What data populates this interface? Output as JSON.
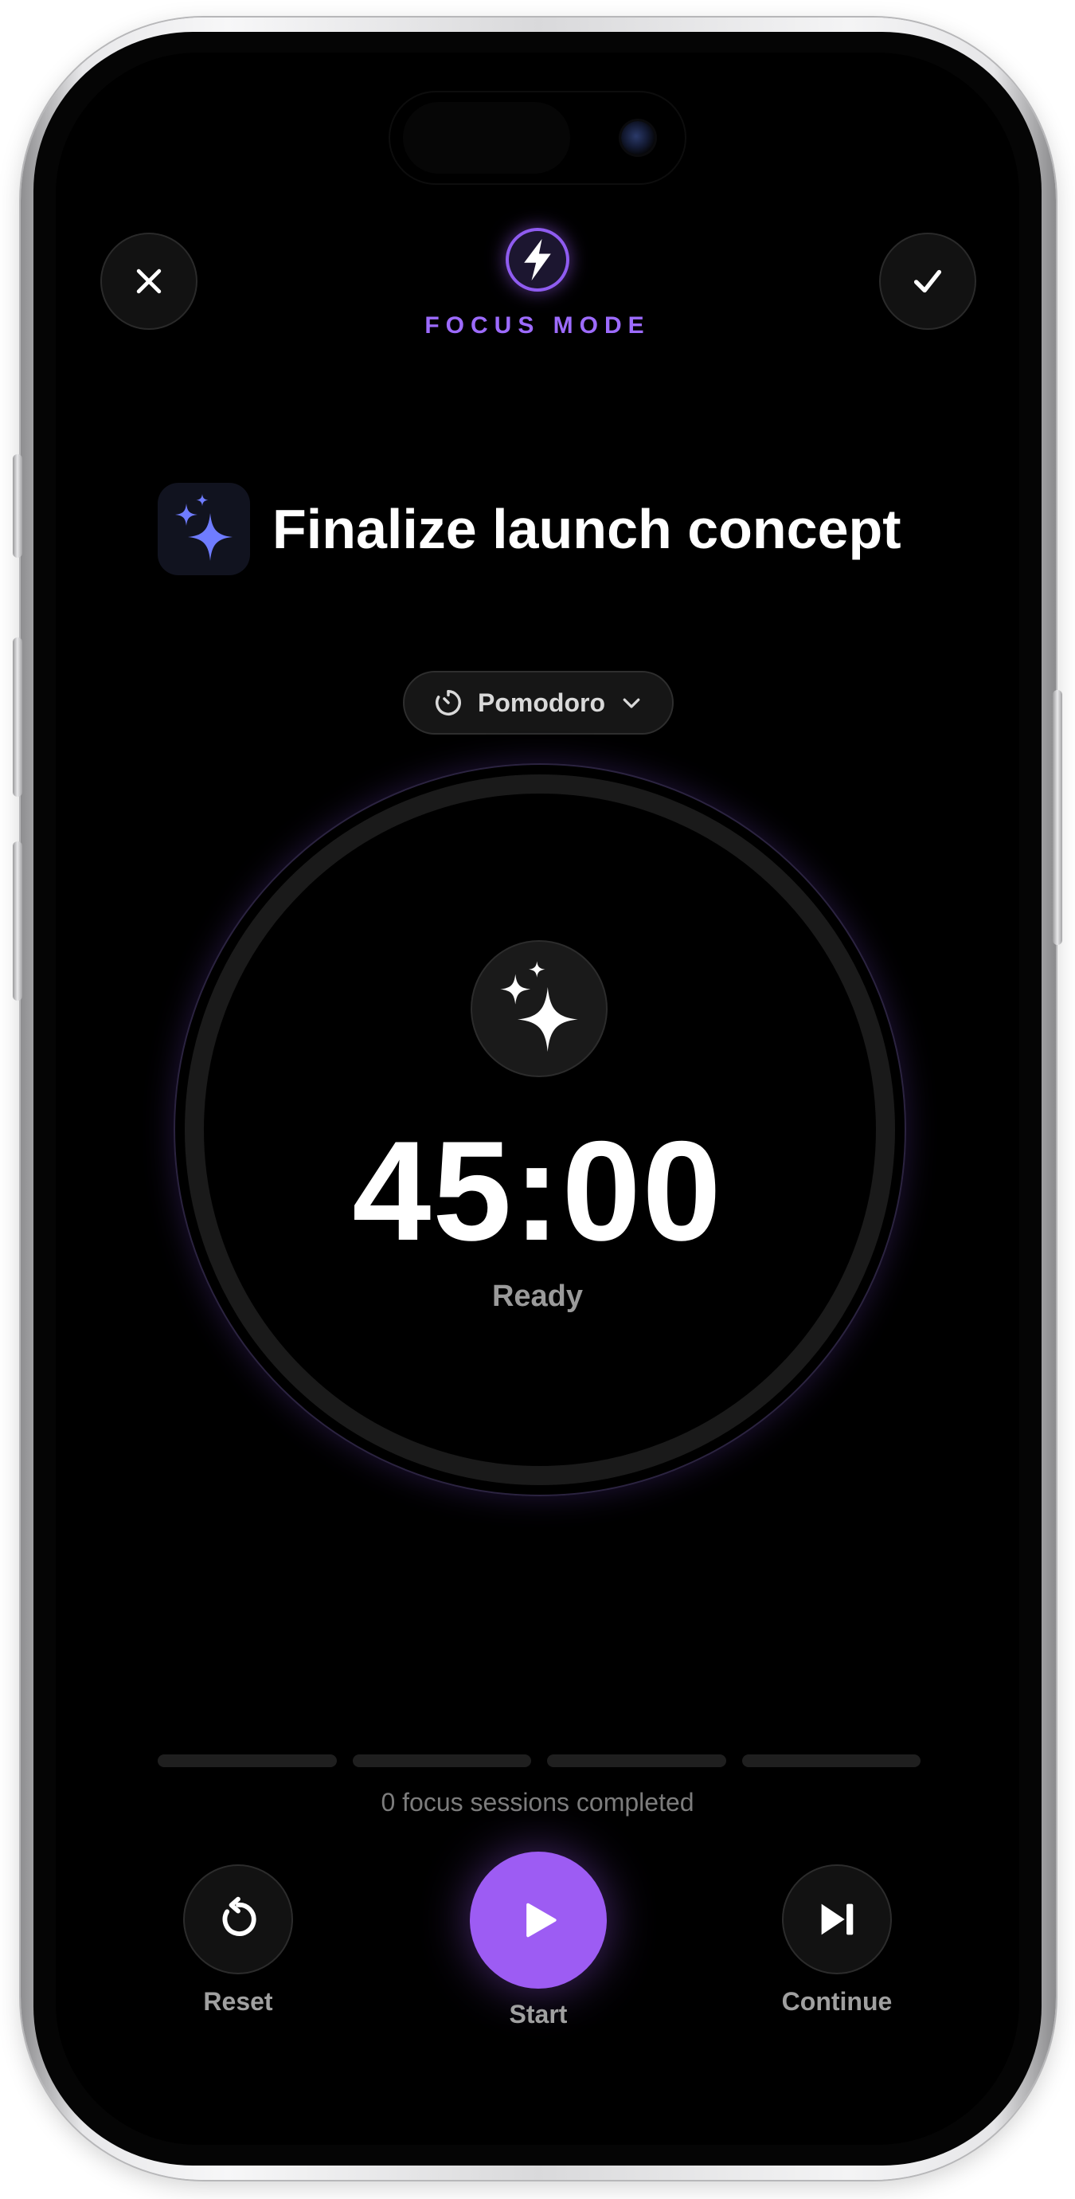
{
  "header": {
    "mode_label": "FOCUS MODE",
    "accent_color": "#9d6bff",
    "close_icon": "close-icon",
    "confirm_icon": "checkmark-icon",
    "mode_icon": "lightning-bolt-icon"
  },
  "task": {
    "title": "Finalize launch concept",
    "icon": "sparkles-icon"
  },
  "timer": {
    "mode_selected": "Pomodoro",
    "value": "45:00",
    "status": "Ready",
    "icon": "sparkles-icon"
  },
  "progress": {
    "segments_total": 4,
    "segments_completed": 0,
    "sessions_text": "0 focus sessions completed"
  },
  "controls": {
    "reset_label": "Reset",
    "start_label": "Start",
    "continue_label": "Continue",
    "start_color": "#9d5cf3"
  }
}
